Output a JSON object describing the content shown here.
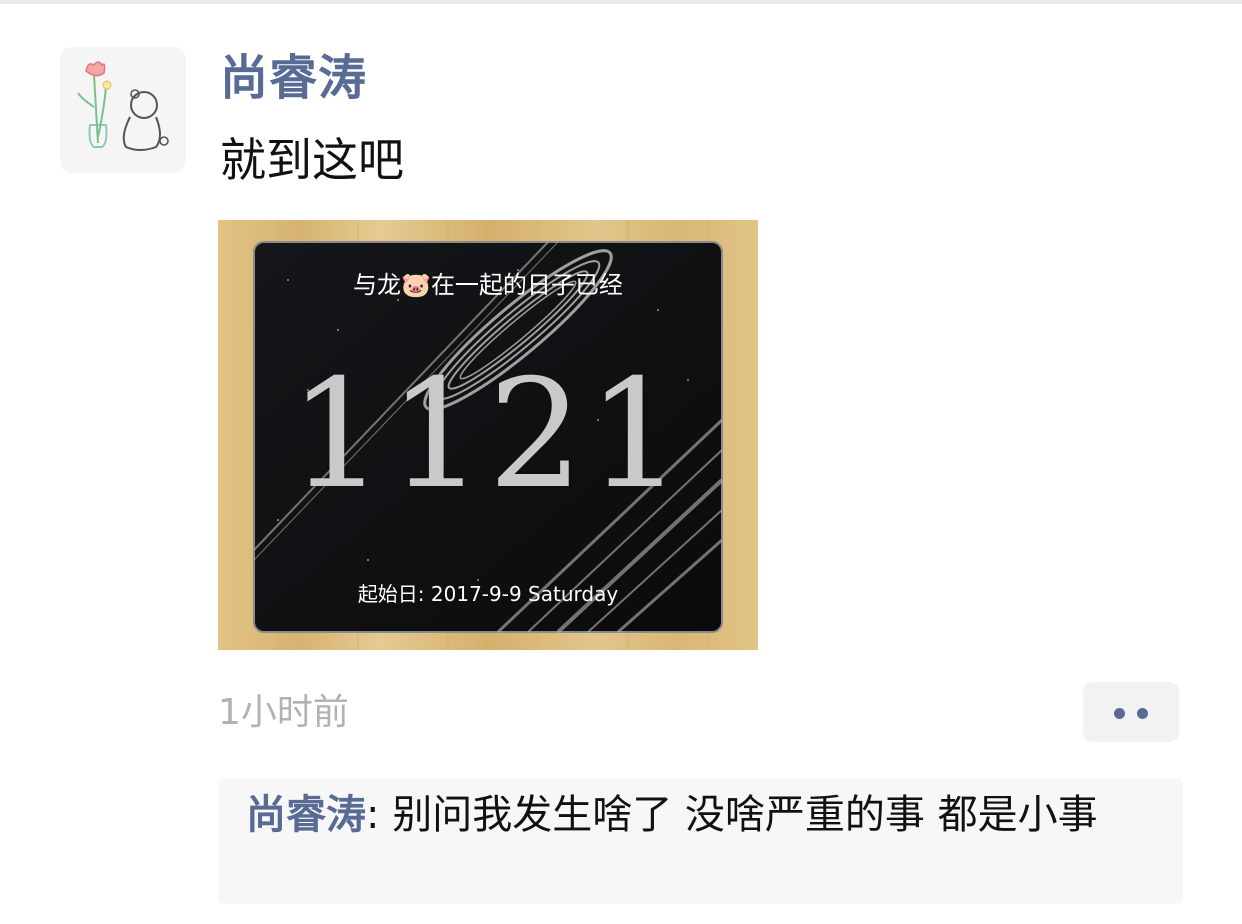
{
  "post": {
    "author": "尚睿涛",
    "text": "就到这吧",
    "time": "1小时前",
    "avatar_icon": "tulip-and-bear-drawing",
    "more_icon": "ellipsis-icon"
  },
  "photo": {
    "caption_before": "与龙",
    "caption_emoji": "🐷",
    "caption_after": "在一起的日子已经",
    "days_count": "1121",
    "start_line": "起始日: 2017-9-9 Saturday"
  },
  "comment": {
    "author": "尚睿涛",
    "separator": ": ",
    "text": "别问我发生啥了 没啥严重的事 都是小事"
  },
  "colors": {
    "link_blue": "#576b95",
    "timestamp_gray": "#b2b2b2",
    "comment_bg": "#f7f7f7",
    "wood": "#d9b777"
  }
}
